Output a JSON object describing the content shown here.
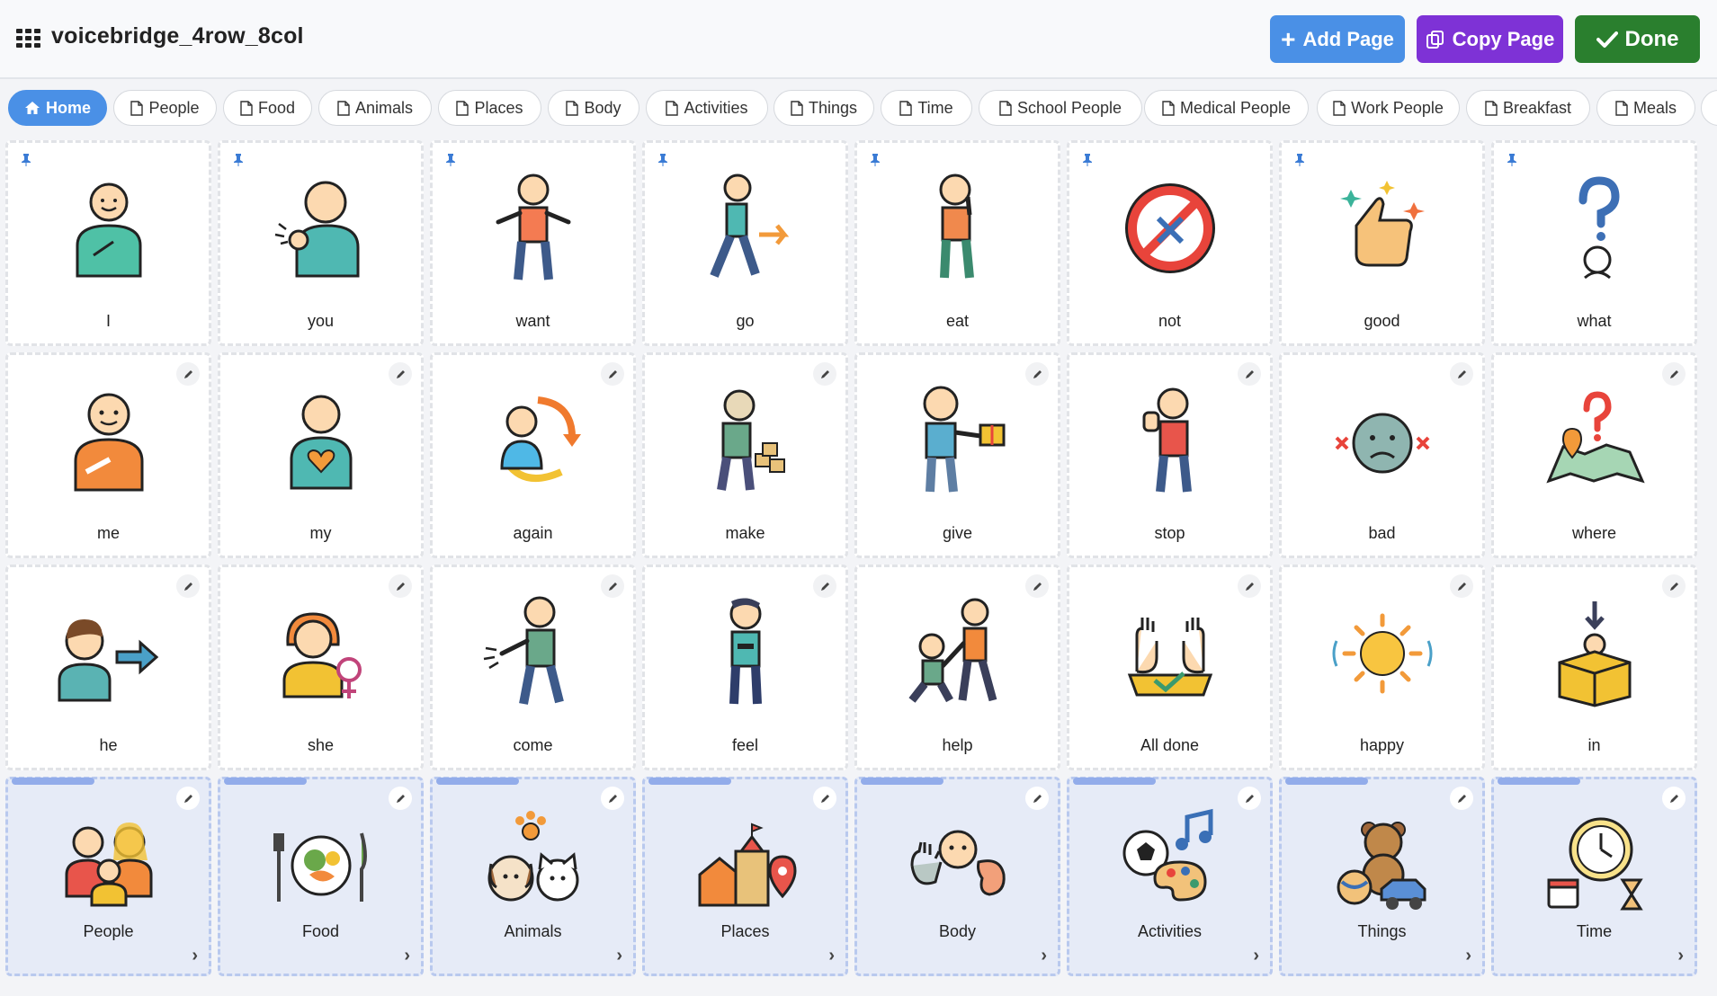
{
  "header": {
    "title": "voicebridge_4row_8col",
    "add_page_label": "Add Page",
    "copy_page_label": "Copy Page",
    "done_label": "Done",
    "add_plus": "+"
  },
  "tabs": [
    {
      "label": "Home",
      "active": true,
      "icon": "home-icon"
    },
    {
      "label": "People",
      "icon": "page-icon"
    },
    {
      "label": "Food",
      "icon": "page-icon"
    },
    {
      "label": "Animals",
      "icon": "page-icon"
    },
    {
      "label": "Places",
      "icon": "page-icon"
    },
    {
      "label": "Body",
      "icon": "page-icon"
    },
    {
      "label": "Activities",
      "icon": "page-icon"
    },
    {
      "label": "Things",
      "icon": "page-icon"
    },
    {
      "label": "Time",
      "icon": "page-icon"
    },
    {
      "label": "School People",
      "icon": "page-icon"
    },
    {
      "label": "Medical People",
      "icon": "page-icon"
    },
    {
      "label": "Work People",
      "icon": "page-icon"
    },
    {
      "label": "Breakfast",
      "icon": "page-icon"
    },
    {
      "label": "Meals",
      "icon": "page-icon"
    }
  ],
  "board": {
    "row1": [
      "I",
      "you",
      "want",
      "go",
      "eat",
      "not",
      "good",
      "what"
    ],
    "row2": [
      "me",
      "my",
      "again",
      "make",
      "give",
      "stop",
      "bad",
      "where"
    ],
    "row3": [
      "he",
      "she",
      "come",
      "feel",
      "help",
      "All done",
      "happy",
      "in"
    ],
    "row4": [
      "People",
      "Food",
      "Animals",
      "Places",
      "Body",
      "Activities",
      "Things",
      "Time"
    ]
  },
  "colors": {
    "add": "#4a90e6",
    "copy": "#7e32d6",
    "done": "#2a7f2e",
    "folder_bg": "#e6ebf7"
  }
}
